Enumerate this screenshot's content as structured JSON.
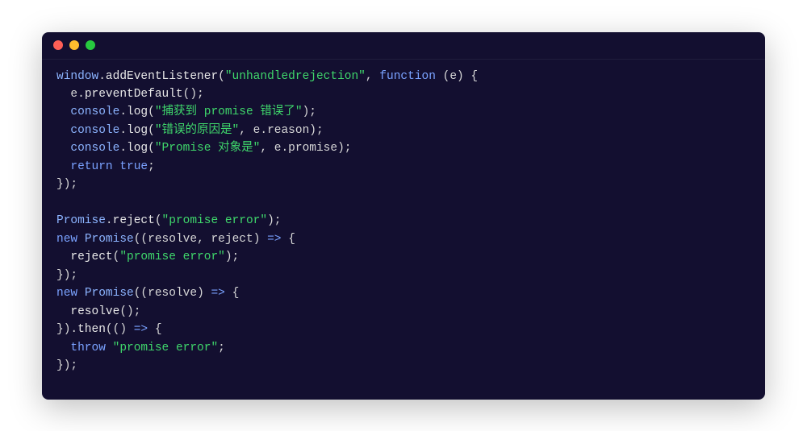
{
  "window": {
    "traffic_lights": {
      "red": "close",
      "yellow": "minimize",
      "green": "zoom"
    }
  },
  "code": {
    "lines": [
      [
        [
          "obj",
          "window"
        ],
        [
          "punc",
          "."
        ],
        [
          "method",
          "addEventListener"
        ],
        [
          "punc",
          "("
        ],
        [
          "str",
          "\"unhandledrejection\""
        ],
        [
          "punc",
          ", "
        ],
        [
          "kw",
          "function"
        ],
        [
          "punc",
          " ("
        ],
        [
          "plain",
          "e"
        ],
        [
          "punc",
          ") {"
        ]
      ],
      [
        [
          "punc",
          "  "
        ],
        [
          "plain",
          "e"
        ],
        [
          "punc",
          "."
        ],
        [
          "method",
          "preventDefault"
        ],
        [
          "punc",
          "();"
        ]
      ],
      [
        [
          "punc",
          "  "
        ],
        [
          "obj",
          "console"
        ],
        [
          "punc",
          "."
        ],
        [
          "method",
          "log"
        ],
        [
          "punc",
          "("
        ],
        [
          "str",
          "\"捕获到 promise 错误了\""
        ],
        [
          "punc",
          ");"
        ]
      ],
      [
        [
          "punc",
          "  "
        ],
        [
          "obj",
          "console"
        ],
        [
          "punc",
          "."
        ],
        [
          "method",
          "log"
        ],
        [
          "punc",
          "("
        ],
        [
          "str",
          "\"错误的原因是\""
        ],
        [
          "punc",
          ", "
        ],
        [
          "plain",
          "e"
        ],
        [
          "punc",
          "."
        ],
        [
          "plain",
          "reason"
        ],
        [
          "punc",
          ");"
        ]
      ],
      [
        [
          "punc",
          "  "
        ],
        [
          "obj",
          "console"
        ],
        [
          "punc",
          "."
        ],
        [
          "method",
          "log"
        ],
        [
          "punc",
          "("
        ],
        [
          "str",
          "\"Promise 对象是\""
        ],
        [
          "punc",
          ", "
        ],
        [
          "plain",
          "e"
        ],
        [
          "punc",
          "."
        ],
        [
          "plain",
          "promise"
        ],
        [
          "punc",
          ");"
        ]
      ],
      [
        [
          "punc",
          "  "
        ],
        [
          "kw",
          "return"
        ],
        [
          "punc",
          " "
        ],
        [
          "kw",
          "true"
        ],
        [
          "punc",
          ";"
        ]
      ],
      [
        [
          "punc",
          "});"
        ]
      ],
      [
        [
          "punc",
          " "
        ]
      ],
      [
        [
          "obj",
          "Promise"
        ],
        [
          "punc",
          "."
        ],
        [
          "method",
          "reject"
        ],
        [
          "punc",
          "("
        ],
        [
          "str",
          "\"promise error\""
        ],
        [
          "punc",
          ");"
        ]
      ],
      [
        [
          "kw",
          "new"
        ],
        [
          "punc",
          " "
        ],
        [
          "obj",
          "Promise"
        ],
        [
          "punc",
          "(("
        ],
        [
          "plain",
          "resolve"
        ],
        [
          "punc",
          ", "
        ],
        [
          "plain",
          "reject"
        ],
        [
          "punc",
          ") "
        ],
        [
          "kw",
          "=>"
        ],
        [
          "punc",
          " {"
        ]
      ],
      [
        [
          "punc",
          "  "
        ],
        [
          "method",
          "reject"
        ],
        [
          "punc",
          "("
        ],
        [
          "str",
          "\"promise error\""
        ],
        [
          "punc",
          ");"
        ]
      ],
      [
        [
          "punc",
          "});"
        ]
      ],
      [
        [
          "kw",
          "new"
        ],
        [
          "punc",
          " "
        ],
        [
          "obj",
          "Promise"
        ],
        [
          "punc",
          "(("
        ],
        [
          "plain",
          "resolve"
        ],
        [
          "punc",
          ") "
        ],
        [
          "kw",
          "=>"
        ],
        [
          "punc",
          " {"
        ]
      ],
      [
        [
          "punc",
          "  "
        ],
        [
          "method",
          "resolve"
        ],
        [
          "punc",
          "();"
        ]
      ],
      [
        [
          "punc",
          "})."
        ],
        [
          "method",
          "then"
        ],
        [
          "punc",
          "(() "
        ],
        [
          "kw",
          "=>"
        ],
        [
          "punc",
          " {"
        ]
      ],
      [
        [
          "punc",
          "  "
        ],
        [
          "kw",
          "throw"
        ],
        [
          "punc",
          " "
        ],
        [
          "str",
          "\"promise error\""
        ],
        [
          "punc",
          ";"
        ]
      ],
      [
        [
          "punc",
          "});"
        ]
      ]
    ]
  }
}
